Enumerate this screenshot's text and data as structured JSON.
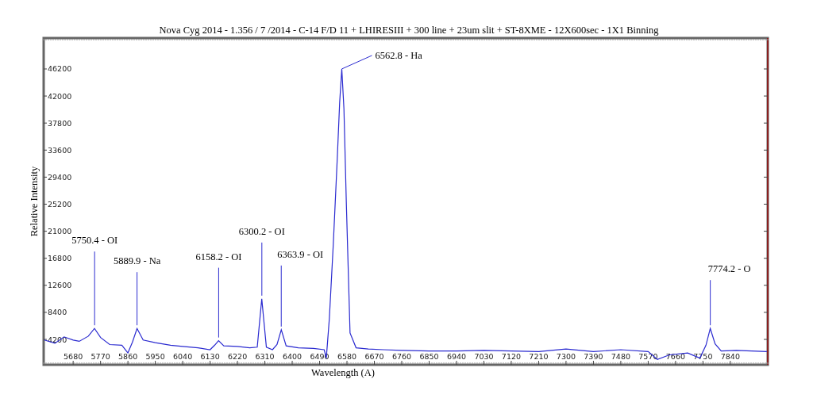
{
  "chart_data": {
    "type": "line",
    "title": "Nova Cyg 2014  - 1.356 / 7 /2014  - C-14 F/D 11 + LHIRESIII + 300 line + 23um slit + ST-8XME  - 12X600sec  - 1X1  Binning",
    "xlabel": "Wavelength (A)",
    "ylabel": "Relative Intensity",
    "x": [
      5585,
      5620,
      5650,
      5680,
      5700,
      5730,
      5750,
      5770,
      5800,
      5840,
      5860,
      5875,
      5890,
      5910,
      5950,
      6000,
      6040,
      6090,
      6130,
      6145,
      6158,
      6175,
      6220,
      6260,
      6285,
      6300,
      6315,
      6335,
      6350,
      6364,
      6380,
      6420,
      6470,
      6505,
      6512,
      6522,
      6535,
      6548,
      6556,
      6563,
      6570,
      6578,
      6590,
      6610,
      6650,
      6700,
      6760,
      6850,
      6940,
      7030,
      7120,
      7210,
      7300,
      7390,
      7480,
      7570,
      7600,
      7640,
      7700,
      7740,
      7760,
      7774,
      7790,
      7810,
      7860,
      7910,
      7960
    ],
    "series": [
      {
        "color": "#2a2ad0",
        "values": [
          4100,
          3600,
          4600,
          4100,
          3900,
          4700,
          5900,
          4500,
          3400,
          3300,
          2100,
          3800,
          5900,
          4100,
          3700,
          3300,
          3100,
          2900,
          2600,
          3300,
          4000,
          3200,
          3100,
          2900,
          3000,
          10500,
          3000,
          2600,
          3400,
          5700,
          3200,
          2900,
          2800,
          2600,
          1300,
          7400,
          19000,
          32300,
          41000,
          46200,
          40000,
          25000,
          5200,
          2900,
          2700,
          2600,
          2500,
          2400,
          2400,
          2500,
          2400,
          2300,
          2700,
          2300,
          2600,
          2300,
          1100,
          1800,
          2100,
          1300,
          3300,
          5900,
          3500,
          2400,
          2500,
          2400,
          2300
        ]
      }
    ],
    "xlim": [
      5583,
      7963
    ],
    "ylim": [
      260,
      51000
    ],
    "xticks": [
      5680,
      5770,
      5860,
      5950,
      6040,
      6130,
      6220,
      6310,
      6400,
      6490,
      6580,
      6670,
      6760,
      6850,
      6940,
      7030,
      7120,
      7210,
      7300,
      7390,
      7480,
      7570,
      7660,
      7750,
      7840
    ],
    "yticks": [
      4200,
      8400,
      12600,
      16800,
      21000,
      25200,
      29400,
      33600,
      37800,
      42000,
      46200
    ],
    "annotations": [
      {
        "text": "5750.4 - OI",
        "x": 5750.4,
        "y": 5900
      },
      {
        "text": "5889.9 - Na",
        "x": 5889.9,
        "y": 5900
      },
      {
        "text": "6158.2 - OI",
        "x": 6158.2,
        "y": 4000
      },
      {
        "text": "6300.2 - OI",
        "x": 6300.2,
        "y": 10500
      },
      {
        "text": "6363.9 - OI",
        "x": 6363.9,
        "y": 5700
      },
      {
        "text": "6562.8 - Ha",
        "x": 6562.8,
        "y": 46200
      },
      {
        "text": "7774.2 - O",
        "x": 7774.2,
        "y": 5900
      }
    ]
  }
}
